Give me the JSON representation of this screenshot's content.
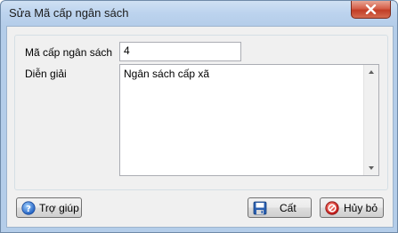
{
  "window": {
    "title": "Sửa Mã cấp ngân sách"
  },
  "form": {
    "code_label": "Mã cấp ngân sách",
    "code_value": "4",
    "desc_label": "Diễn giải",
    "desc_value": "Ngân sách cấp xã"
  },
  "buttons": {
    "help": "Trợ giúp",
    "save": "Cất",
    "cancel": "Hủy bỏ"
  },
  "icons": {
    "close": "close-icon",
    "help": "help-icon",
    "save": "save-icon",
    "cancel": "cancel-icon"
  }
}
